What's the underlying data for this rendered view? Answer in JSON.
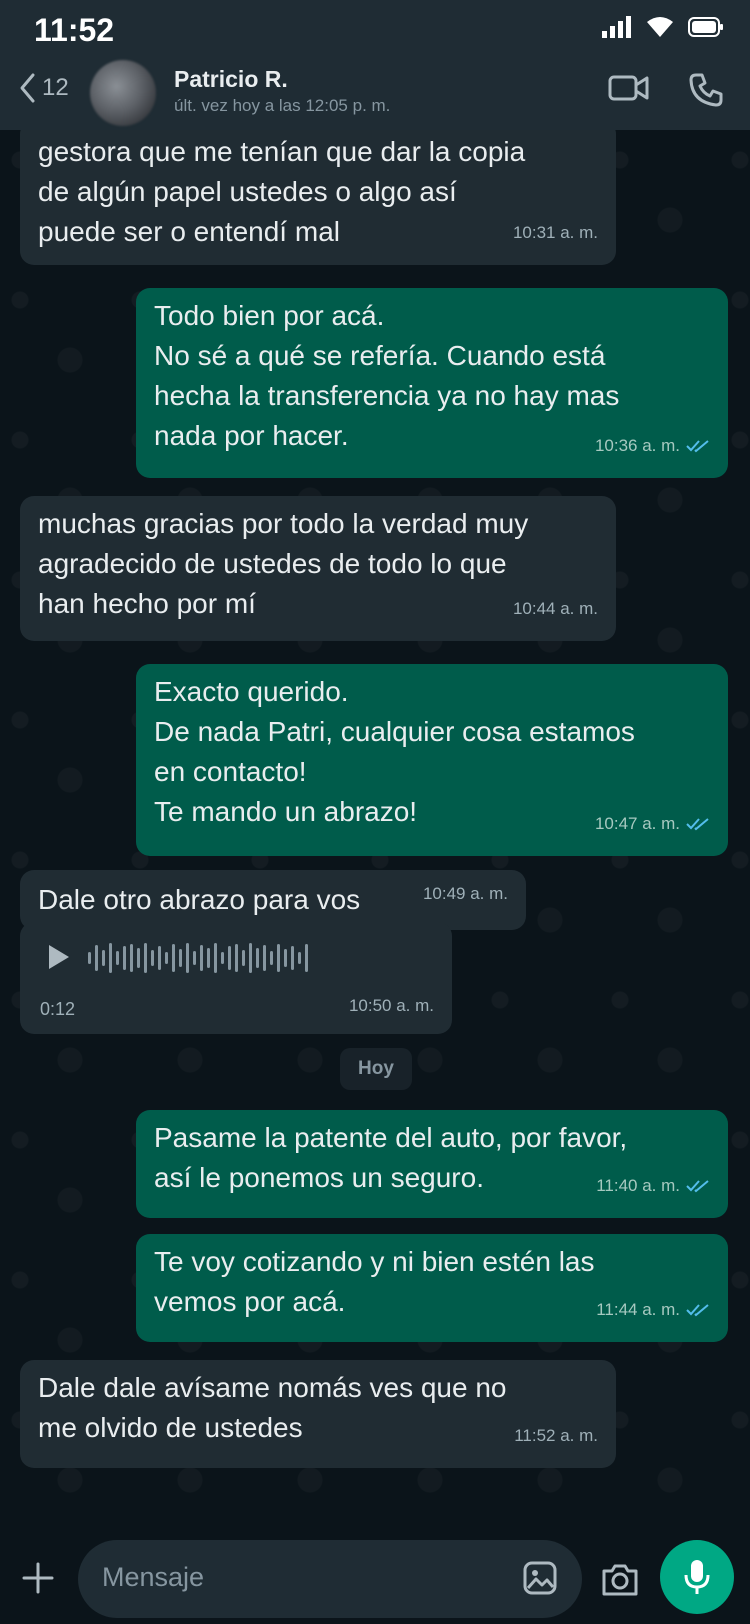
{
  "status_bar": {
    "time": "11:52"
  },
  "header": {
    "back_count": "12",
    "contact_name": "Patricio R.",
    "last_seen": "últ. vez hoy a las 12:05 p. m."
  },
  "messages": [
    {
      "direction": "in",
      "lines": [
        "gestora que me tenían que dar la copia",
        "de algún papel ustedes o algo así",
        "puede ser o entendí mal"
      ],
      "time": "10:31 a. m."
    },
    {
      "direction": "out",
      "lines": [
        "Todo bien por acá.",
        "No sé a qué se refería. Cuando está",
        "hecha la transferencia ya no hay mas",
        "nada por hacer."
      ],
      "time": "10:36 a. m.",
      "read": true
    },
    {
      "direction": "in",
      "lines": [
        "muchas gracias por todo la verdad muy",
        "agradecido de ustedes de todo lo que",
        "han hecho por mí"
      ],
      "time": "10:44 a. m."
    },
    {
      "direction": "out",
      "lines": [
        "Exacto querido.",
        "De nada Patri, cualquier cosa estamos",
        "en contacto!",
        "Te mando un abrazo!"
      ],
      "time": "10:47 a. m.",
      "read": true
    },
    {
      "direction": "in",
      "lines": [
        "Dale otro abrazo para vos"
      ],
      "time": "10:49 a. m."
    },
    {
      "direction": "out",
      "lines": [
        "Pasame la patente del auto, por favor,",
        "así le ponemos un seguro."
      ],
      "time": "11:40 a. m.",
      "read": true
    },
    {
      "direction": "out",
      "lines": [
        "Te voy cotizando y ni bien estén las",
        "vemos por acá."
      ],
      "time": "11:44 a. m.",
      "read": true
    },
    {
      "direction": "in",
      "lines": [
        "Dale dale avísame nomás ves que no",
        "me olvido de ustedes"
      ],
      "time": "11:52 a. m."
    }
  ],
  "audio_message": {
    "duration": "0:12",
    "time": "10:50 a. m."
  },
  "day_separator": "Hoy",
  "composer": {
    "placeholder": "Mensaje"
  },
  "colors": {
    "background": "#0b141a",
    "incoming_bubble": "#202c33",
    "outgoing_bubble": "#005c4b",
    "accent": "#00a884",
    "read_tick": "#53bdeb"
  },
  "icons": [
    "signal-icon",
    "wifi-icon",
    "battery-icon",
    "back-chevron-icon",
    "video-call-icon",
    "phone-icon",
    "play-icon",
    "plus-icon",
    "sticker-icon",
    "camera-icon",
    "mic-icon",
    "double-check-icon"
  ]
}
